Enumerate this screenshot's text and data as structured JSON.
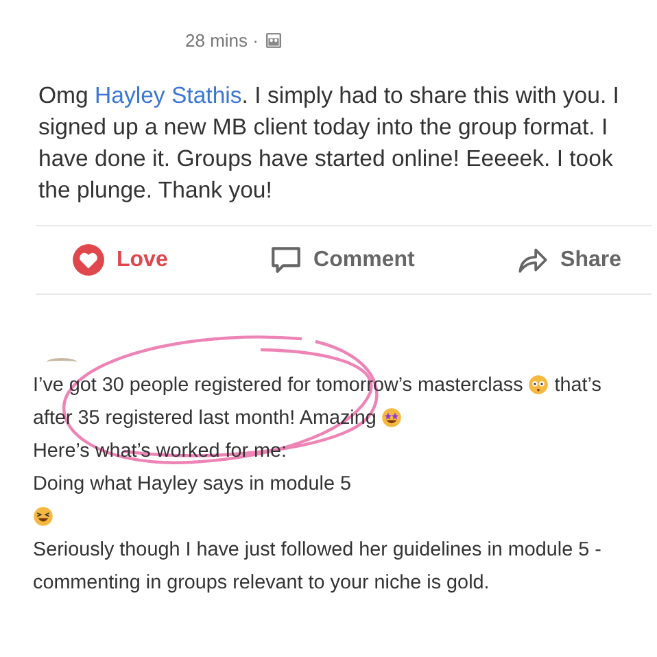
{
  "post": {
    "time": "28 mins ·",
    "message": [
      {
        "kind": "text",
        "text": "Omg "
      },
      {
        "kind": "mention",
        "text": "Hayley Stathis"
      },
      {
        "kind": "text",
        "text": ". I simply had to share this with you. I signed up a new MB client today into the group format. I have done it. Groups have started online! Eeeeek. I took the plunge. Thank you!"
      }
    ],
    "actions": [
      {
        "kind": "love",
        "label": "Love",
        "selected": true
      },
      {
        "kind": "comment",
        "label": "Comment",
        "selected": false
      },
      {
        "kind": "share",
        "label": "Share",
        "selected": false
      }
    ]
  },
  "comment": {
    "lines": [
      [
        {
          "kind": "text",
          "text": "I’ve got 30 people registered for tomorrow’s masterclass"
        },
        {
          "kind": "flushed"
        },
        {
          "kind": "text",
          "text": "that’s"
        }
      ],
      [
        {
          "kind": "text",
          "text": "after 35 registered last month! Amazing"
        },
        {
          "kind": "starstruck"
        }
      ],
      [
        {
          "kind": "text",
          "text": "Here’s what’s worked for me:"
        }
      ],
      [
        {
          "kind": "text",
          "text": "Doing what Hayley says in module 5"
        }
      ],
      [
        {
          "kind": "laughing"
        }
      ],
      [
        {
          "kind": "text",
          "text": "Seriously though I have just followed her guidelines in module 5 -"
        }
      ],
      [
        {
          "kind": "text",
          "text": "commenting in groups relevant to your niche is gold."
        }
      ]
    ]
  }
}
